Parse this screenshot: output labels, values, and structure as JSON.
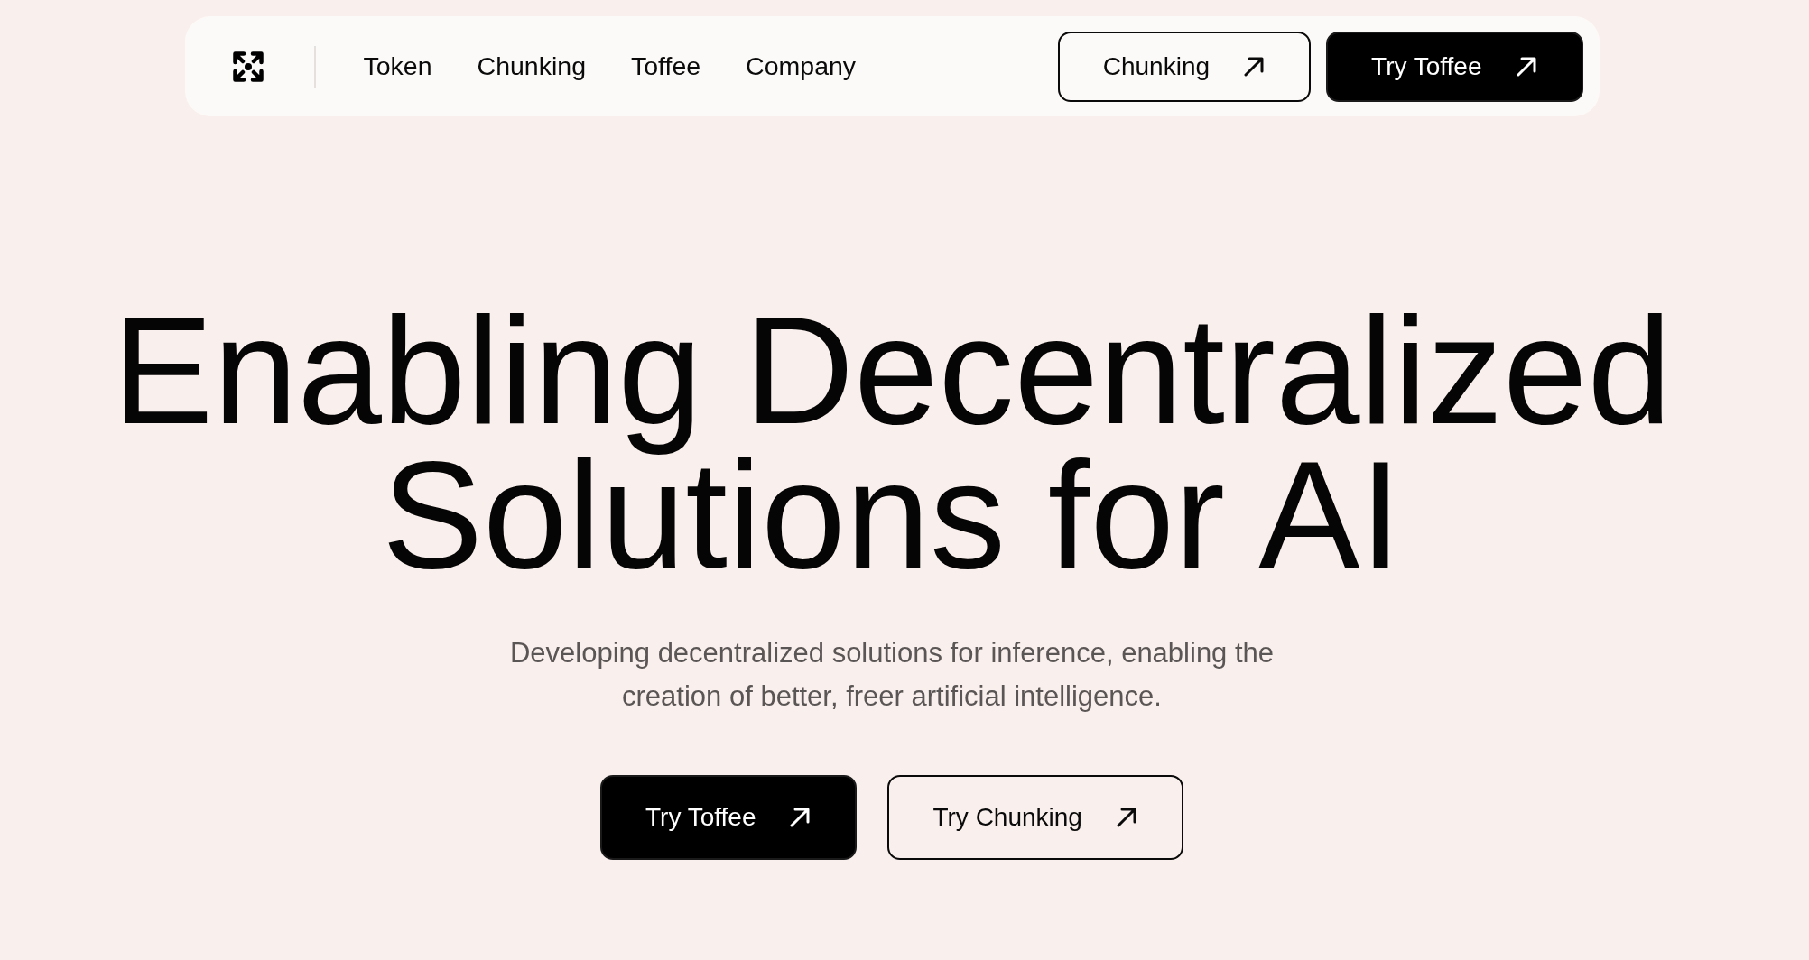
{
  "nav": {
    "links": [
      "Token",
      "Chunking",
      "Toffee",
      "Company"
    ],
    "buttons": [
      {
        "label": "Chunking",
        "kind": "outline"
      },
      {
        "label": "Try Toffee",
        "kind": "solid"
      }
    ]
  },
  "hero": {
    "title": "Enabling Decentralized Solutions for AI",
    "subtitle": "Developing decentralized solutions for inference, enabling the creation of better, freer artificial intelligence.",
    "buttons": [
      {
        "label": "Try Toffee",
        "kind": "solid"
      },
      {
        "label": "Try Chunking",
        "kind": "outline"
      }
    ]
  }
}
